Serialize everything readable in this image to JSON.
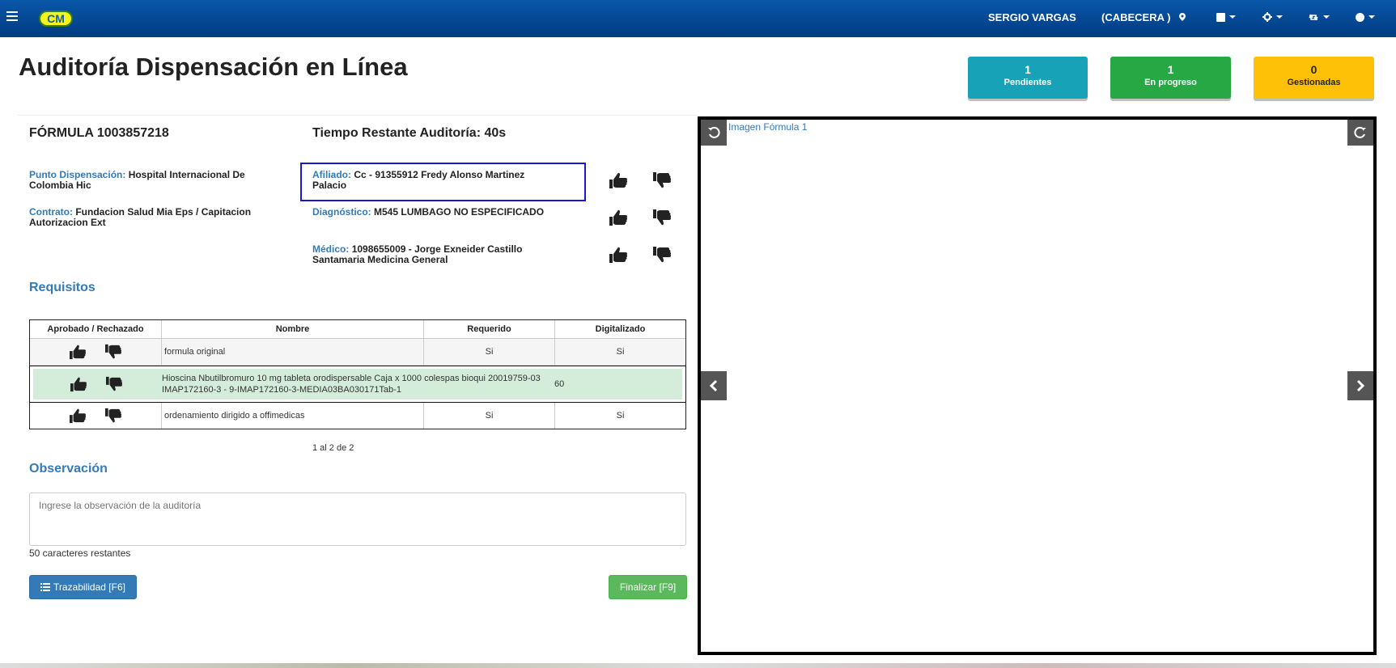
{
  "navbar": {
    "logo_text": "CM",
    "user": "SERGIO VARGAS",
    "branch": "(CABECERA )"
  },
  "page": {
    "title": "Auditoría Dispensación en Línea"
  },
  "stats": {
    "pendientes": {
      "count": "1",
      "label": "Pendientes",
      "color": "#17a2b8"
    },
    "en_progreso": {
      "count": "1",
      "label": "En progreso",
      "color": "#28a745"
    },
    "gestionadas": {
      "count": "0",
      "label": "Gestionadas",
      "color": "#ffc107"
    }
  },
  "formula": {
    "title": "FÓRMULA 1003857218",
    "timer": "Tiempo Restante Auditoría: 40s",
    "punto_label": "Punto Dispensación:",
    "punto_value": "Hospital Internacional De Colombia Hic",
    "contrato_label": "Contrato:",
    "contrato_value": "Fundacion Salud Mia Eps / Capitacion Autorizacion Ext",
    "afiliado_label": "Afiliado:",
    "afiliado_value": "Cc - 91355912 Fredy Alonso Martinez Palacio",
    "diagnostico_label": "Diagnóstico:",
    "diagnostico_value": "M545 LUMBAGO NO ESPECIFICADO",
    "medico_label": "Médico:",
    "medico_value": "1098655009 - Jorge Exneider Castillo Santamaria Medicina General"
  },
  "requisitos": {
    "title": "Requisitos",
    "headers": [
      "Aprobado / Rechazado",
      "Nombre",
      "Requerido",
      "Digitalizado"
    ],
    "rows": [
      {
        "nombre": "formula original",
        "requerido": "Si",
        "digitalizado": "Si"
      },
      {
        "nombre": "Hioscina Nbutilbromuro 10 mg tableta orodispersable Caja x 1000 colespas bioqui 20019759-03 IMAP172160-3 - 9-IMAP172160-3-MEDIA03BA030171Tab-1",
        "requerido": "60",
        "digitalizado": ""
      },
      {
        "nombre": "ordenamiento dirigido a offimedicas",
        "requerido": "Si",
        "digitalizado": "Si"
      }
    ],
    "pager": "1 al 2 de 2"
  },
  "observacion": {
    "title": "Observación",
    "placeholder": "Ingrese la observación de la auditoría",
    "remaining": "50 caracteres restantes"
  },
  "buttons": {
    "trazabilidad": "Trazabilidad [F6]",
    "finalizar": "Finalizar [F9]"
  },
  "viewer": {
    "title": "Imagen Fórmula 1"
  }
}
